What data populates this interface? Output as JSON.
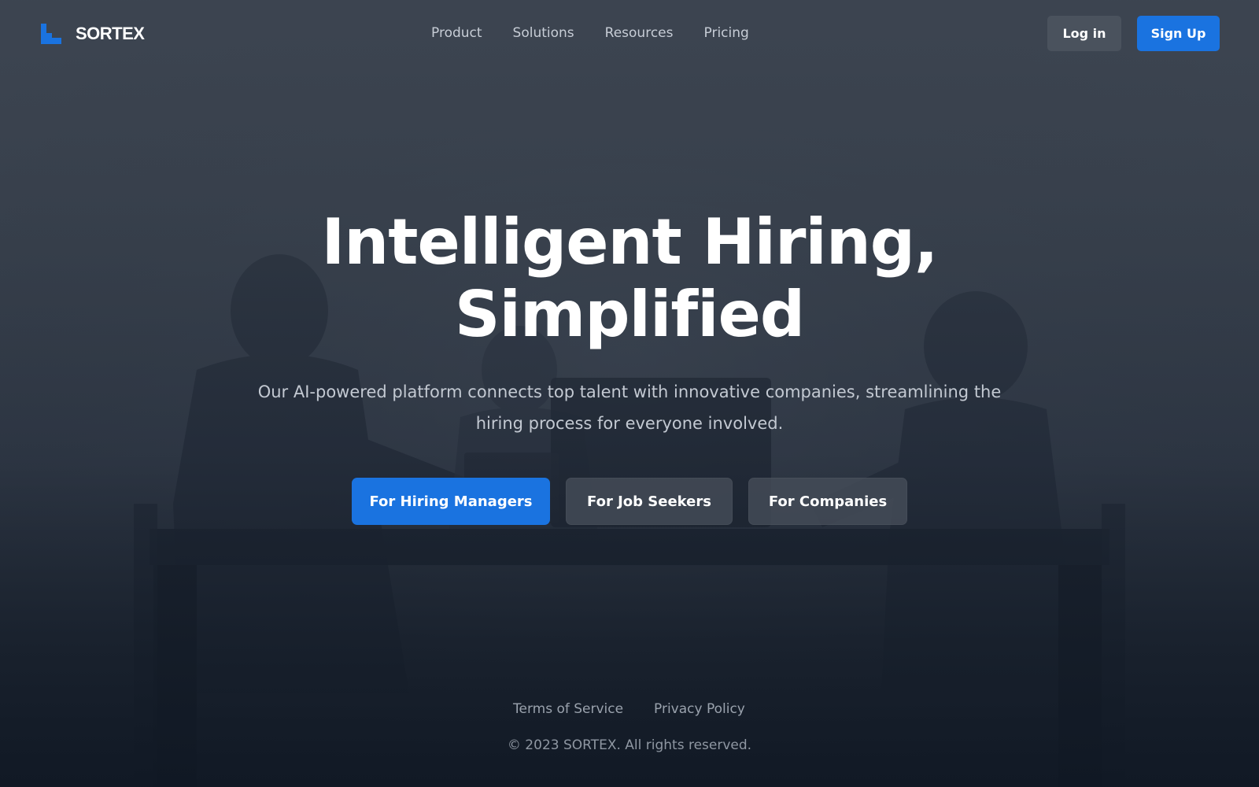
{
  "brand": {
    "name": "SORTEX",
    "logo_icon": "step-logo-icon",
    "accent_color": "#1a73e0"
  },
  "nav": {
    "links": [
      "Product",
      "Solutions",
      "Resources",
      "Pricing"
    ],
    "login_label": "Log in",
    "signup_label": "Sign Up"
  },
  "hero": {
    "title_line1": "Intelligent Hiring,",
    "title_line2": "Simplified",
    "subtitle": "Our AI-powered platform connects top talent with innovative companies, streamlining the hiring process for everyone involved.",
    "cta_primary": "For Hiring Managers",
    "cta_seekers": "For Job Seekers",
    "cta_companies": "For Companies"
  },
  "footer": {
    "terms_label": "Terms of Service",
    "privacy_label": "Privacy Policy",
    "copyright": "© 2023 SORTEX. All rights reserved."
  },
  "background": {
    "image": "meeting-photo",
    "overlay_color": "#1b2230"
  }
}
